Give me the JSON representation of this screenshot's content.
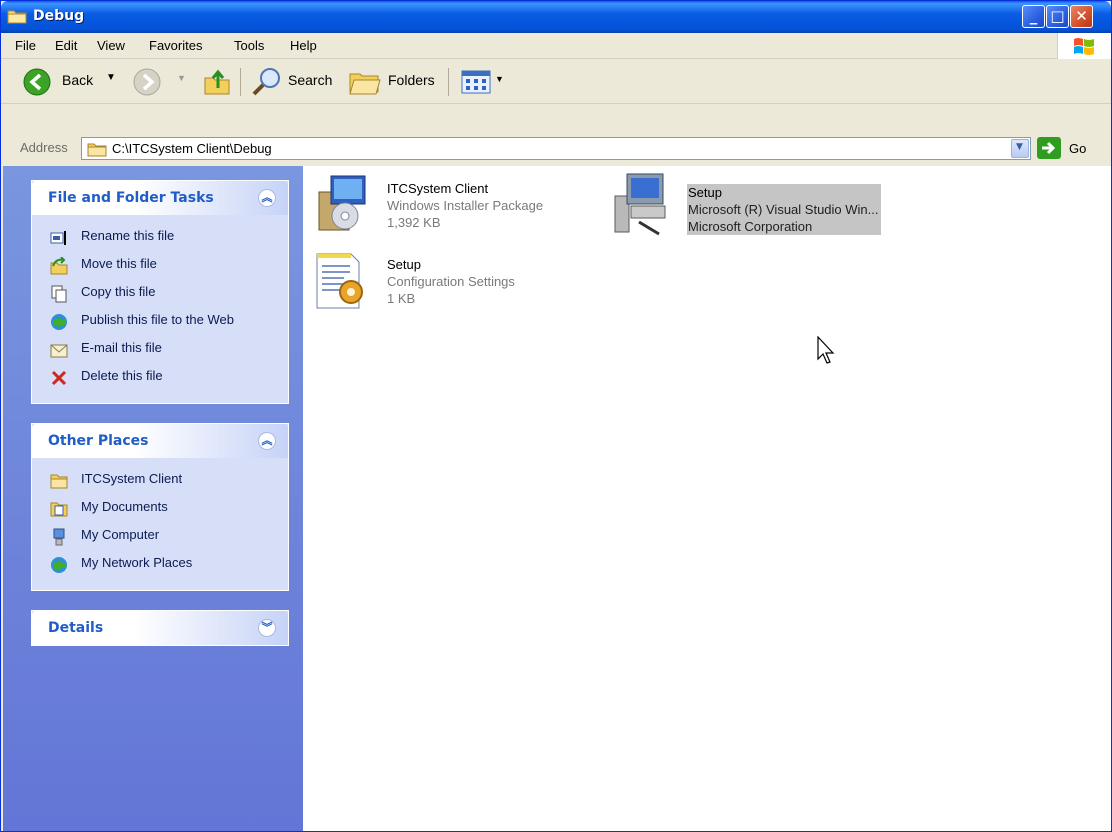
{
  "window": {
    "title": "Debug"
  },
  "menu": [
    "File",
    "Edit",
    "View",
    "Favorites",
    "Tools",
    "Help"
  ],
  "toolbar": {
    "back_label": "Back",
    "search_label": "Search",
    "folders_label": "Folders"
  },
  "address": {
    "label": "Address",
    "path": "C:\\ITCSystem Client\\Debug",
    "go_label": "Go"
  },
  "tasks_panel": {
    "title": "File and Folder Tasks",
    "items": [
      {
        "label": "Rename this file",
        "icon": "rename-icon"
      },
      {
        "label": "Move this file",
        "icon": "move-icon"
      },
      {
        "label": "Copy this file",
        "icon": "copy-icon"
      },
      {
        "label": "Publish this file to the Web",
        "icon": "publish-icon"
      },
      {
        "label": "E-mail this file",
        "icon": "email-icon"
      },
      {
        "label": "Delete this file",
        "icon": "delete-icon"
      }
    ]
  },
  "places_panel": {
    "title": "Other Places",
    "items": [
      {
        "label": "ITCSystem Client",
        "icon": "folder-icon"
      },
      {
        "label": "My Documents",
        "icon": "my-documents-icon"
      },
      {
        "label": "My Computer",
        "icon": "my-computer-icon"
      },
      {
        "label": "My Network Places",
        "icon": "network-places-icon"
      }
    ]
  },
  "details_panel": {
    "title": "Details"
  },
  "files": [
    {
      "name": "ITCSystem Client",
      "line2": "Windows Installer Package",
      "line3": "1,392 KB",
      "icon": "installer-package-icon",
      "selected": false
    },
    {
      "name": "Setup",
      "line2": "Microsoft (R) Visual Studio Win...",
      "line3": "Microsoft Corporation",
      "icon": "setup-exe-icon",
      "selected": true
    },
    {
      "name": "Setup",
      "line2": "Configuration Settings",
      "line3": "1 KB",
      "icon": "config-settings-icon",
      "selected": false
    }
  ],
  "colors": {
    "titlebar": "#0a5ce5",
    "taskpane": "#6f86da",
    "panel_title": "#215dc6",
    "selection": "#c5c5c5"
  }
}
